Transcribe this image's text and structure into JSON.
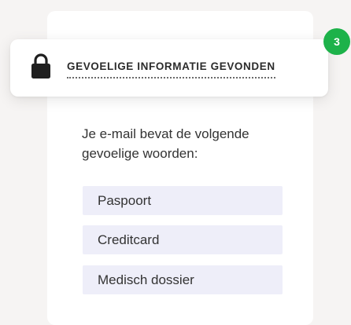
{
  "alert": {
    "title": "GEVOELIGE INFORMATIE GEVONDEN",
    "count": "3",
    "icon": "lock-icon"
  },
  "message": {
    "text": "Je e-mail bevat de volgende gevoelige woorden:"
  },
  "keywords": [
    {
      "label": "Paspoort"
    },
    {
      "label": "Creditcard"
    },
    {
      "label": "Medisch dossier"
    }
  ],
  "colors": {
    "badge": "#1db24a",
    "keyword_bg": "#eeeef9",
    "page_bg": "#f6f4f3"
  }
}
